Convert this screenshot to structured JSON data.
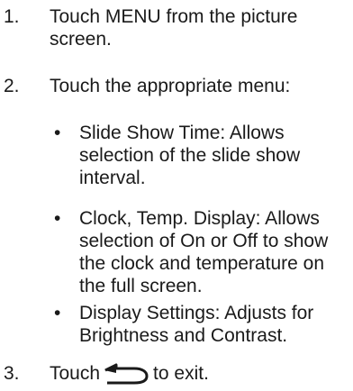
{
  "steps": [
    {
      "number": "1.",
      "text": "Touch MENU from the picture screen."
    },
    {
      "number": "2.",
      "text": "Touch the appropriate menu:"
    },
    {
      "number": "3.",
      "text_before": "Touch",
      "icon": "back-arrow-icon",
      "text_after": "to exit."
    }
  ],
  "bullets": [
    {
      "symbol": "•",
      "text": "Slide Show Time: Allows selection of the slide show interval."
    },
    {
      "symbol": "•",
      "text": "Clock, Temp. Display: Allows selection of On or Off to show the clock and temperature on the full screen."
    },
    {
      "symbol": "•",
      "text": "Display Settings: Adjusts for Brightness and Contrast."
    }
  ]
}
